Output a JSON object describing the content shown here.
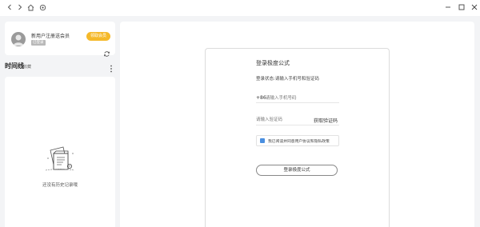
{
  "window": {
    "controls": [
      "back-icon",
      "forward-icon",
      "home-icon",
      "settings-icon",
      "minimize-icon",
      "maximize-icon",
      "close-icon"
    ]
  },
  "user": {
    "name": "新用户注册送会员",
    "sub_tag": "已登录",
    "vip_button": "领取会员",
    "icons": [
      "avatar",
      "refresh-icon"
    ]
  },
  "timeline": {
    "title": "时间线",
    "favorites": "收藏",
    "empty_text": "还没有历史记录哦",
    "icons": [
      "more-vertical-icon",
      "empty-history-illustration"
    ]
  },
  "login": {
    "title": "登录极度公式",
    "status": "登录状态:请输入手机号和验证码",
    "phone_prefix": "+86",
    "phone_placeholder": "请输入手机号码",
    "code_placeholder": "请输入验证码",
    "get_code": "获取验证码",
    "agreement": "我已阅读并同意用户协议和隐私政策",
    "agreement_checked": true,
    "submit": "登录极度公式"
  },
  "colors": {
    "accent_vip": "#f5b92a",
    "checkbox": "#4a8fe0",
    "background": "#f3f4f6"
  }
}
